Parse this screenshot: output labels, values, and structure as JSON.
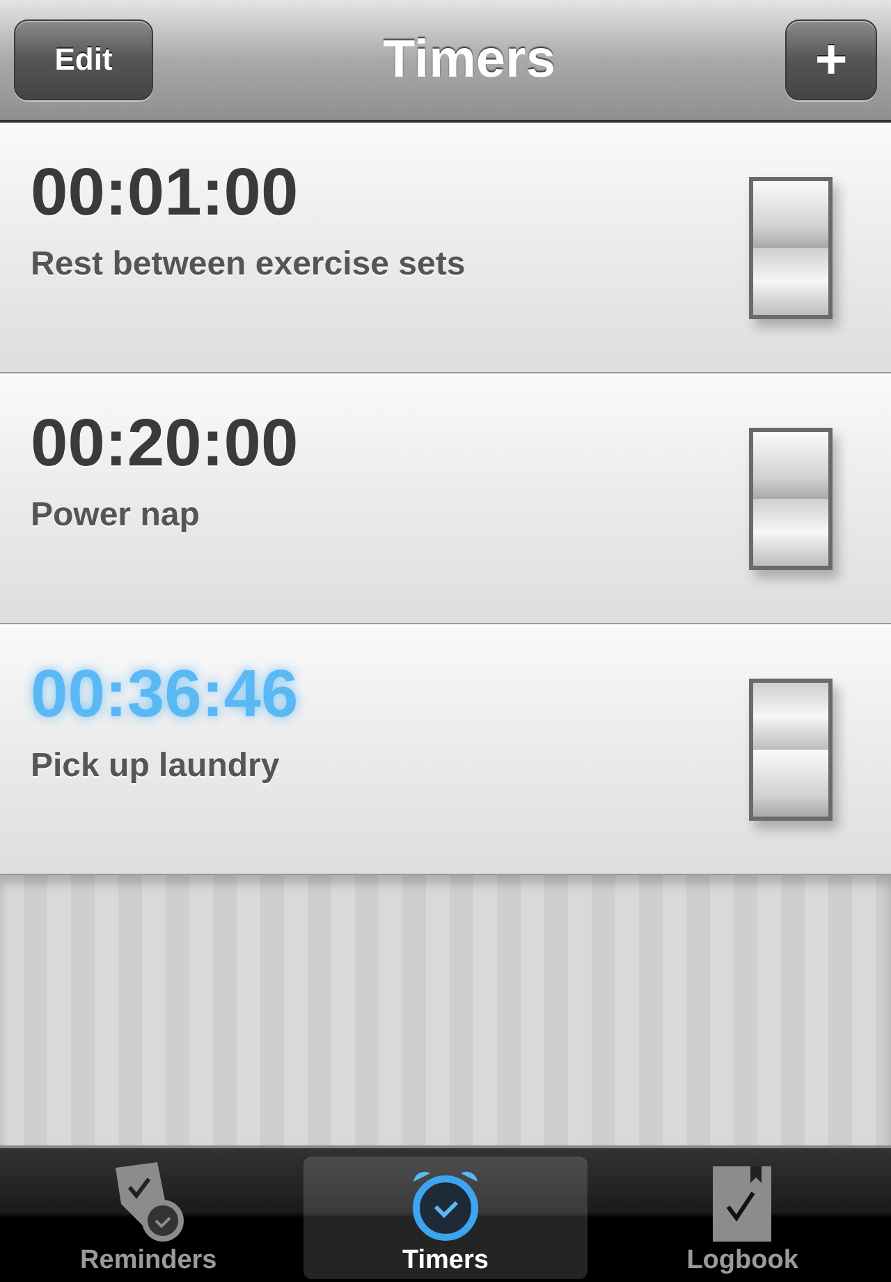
{
  "nav_bar": {
    "title": "Timers",
    "edit_button": "Edit",
    "add_button": "+"
  },
  "timers": [
    {
      "time": "00:01:00",
      "label": "Rest between exercise sets",
      "on": false
    },
    {
      "time": "00:20:00",
      "label": "Power nap",
      "on": false
    },
    {
      "time": "00:36:46",
      "label": "Pick up laundry",
      "on": true
    }
  ],
  "tab_bar": [
    {
      "label": "Reminders",
      "kind": "reminders",
      "selected": false
    },
    {
      "label": "Timers",
      "kind": "timers",
      "selected": true
    },
    {
      "label": "Logbook",
      "kind": "logbook",
      "selected": false
    }
  ]
}
